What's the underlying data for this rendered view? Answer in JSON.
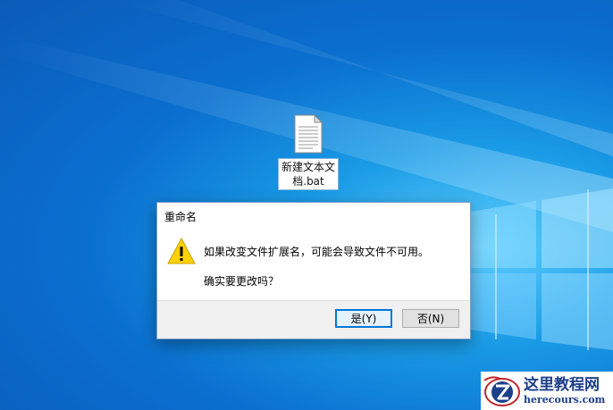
{
  "desktop": {
    "file": {
      "name": "新建文本文档.bat",
      "icon": "text-file-icon"
    }
  },
  "dialog": {
    "title": "重命名",
    "icon": "warning-icon",
    "message": "如果改变文件扩展名，可能会导致文件不可用。",
    "question": "确实要更改吗？",
    "buttons": {
      "yes": "是(Y)",
      "no": "否(N)"
    }
  },
  "watermark": {
    "title": "这里教程网",
    "url": "herecours.com"
  },
  "colors": {
    "desktop_blue": "#0a6fcf",
    "focus_blue": "#0078d7",
    "warning_yellow": "#ffd200",
    "watermark_blue": "#1d3f8a"
  }
}
